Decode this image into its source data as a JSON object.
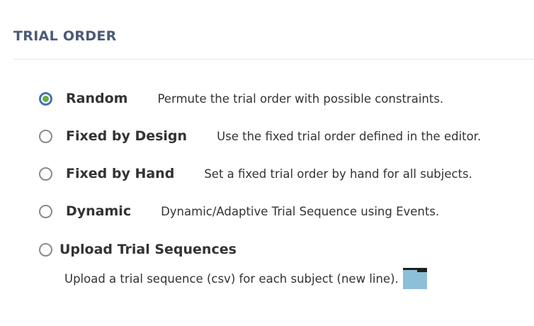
{
  "section": {
    "title": "TRIAL ORDER"
  },
  "options": [
    {
      "label": "Random",
      "description": "Permute the trial order with possible constraints.",
      "checked": true
    },
    {
      "label": "Fixed by Design",
      "description": "Use the fixed trial order defined in the editor.",
      "checked": false
    },
    {
      "label": "Fixed by Hand",
      "description": "Set a fixed trial order by hand for all subjects.",
      "checked": false
    },
    {
      "label": "Dynamic",
      "description": "Dynamic/Adaptive Trial Sequence using Events.",
      "checked": false
    },
    {
      "label": "Upload Trial Sequences",
      "description": "Upload a trial sequence (csv) for each subject (new line).",
      "checked": false
    }
  ],
  "icons": {
    "folder": "folder-icon"
  },
  "colors": {
    "title": "#4a5a78",
    "radio_checked_ring": "#4a72b0",
    "radio_checked_dot": "#6aab4a",
    "folder_body": "#8cc0d8",
    "folder_tab": "#1f1f1f"
  }
}
